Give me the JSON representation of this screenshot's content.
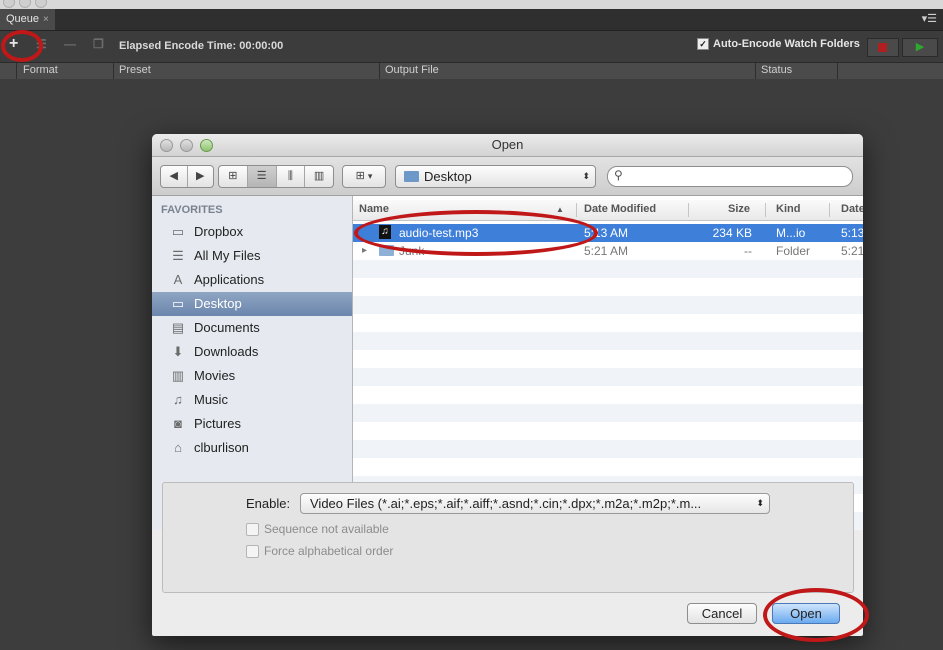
{
  "app": {
    "tab_label": "Queue",
    "tab_close": "×",
    "panel_menu": "▾☰",
    "toolbar": {
      "add_icon": "+",
      "remove_icon": "—",
      "duplicate_icon": "❐",
      "list_icon": "☰",
      "elapsed_label": "Elapsed Encode Time: 00:00:00",
      "auto_encode_label": "Auto-Encode Watch Folders",
      "auto_encode_checked": "✓",
      "play_icon": "▶"
    },
    "columns": [
      "Format",
      "Preset",
      "Output File",
      "Status"
    ]
  },
  "dialog": {
    "title": "Open",
    "nav": {
      "back": "◀",
      "forward": "▶"
    },
    "view_buttons": [
      "⊞",
      "☰",
      "⫼",
      "▥"
    ],
    "arrange": {
      "icon": "⊞",
      "arrow": "▾"
    },
    "location": {
      "label": "Desktop",
      "arrow": "⬍"
    },
    "search": {
      "placeholder": "",
      "icon": "⚲"
    },
    "sidebar": {
      "header": "FAVORITES",
      "items": [
        {
          "label": "Dropbox",
          "icon": "▭"
        },
        {
          "label": "All My Files",
          "icon": "☰"
        },
        {
          "label": "Applications",
          "icon": "A"
        },
        {
          "label": "Desktop",
          "icon": "▭"
        },
        {
          "label": "Documents",
          "icon": "▤"
        },
        {
          "label": "Downloads",
          "icon": "⬇"
        },
        {
          "label": "Movies",
          "icon": "▥"
        },
        {
          "label": "Music",
          "icon": "♫"
        },
        {
          "label": "Pictures",
          "icon": "◙"
        },
        {
          "label": "clburlison",
          "icon": "⌂"
        }
      ],
      "selected": "Desktop"
    },
    "file_list": {
      "headers": {
        "name": "Name",
        "sort": "▲",
        "date_modified": "Date Modified",
        "size": "Size",
        "kind": "Kind",
        "date_added": "Date"
      },
      "rows": [
        {
          "name": "audio-test.mp3",
          "icon": "♫",
          "date": "5:13 AM",
          "size": "234 KB",
          "kind": "M...io",
          "added": "5:13"
        },
        {
          "name": "Junk",
          "icon": "▸",
          "date": "5:21 AM",
          "size": "--",
          "kind": "Folder",
          "added": "5:21"
        }
      ]
    },
    "options": {
      "enable_label": "Enable:",
      "enable_value": "Video Files (*.ai;*.eps;*.aif;*.aiff;*.asnd;*.cin;*.dpx;*.m2a;*.m2p;*.m...",
      "enable_arrow": "⬍",
      "sequence_label": "Sequence not available",
      "force_label": "Force alphabetical order"
    },
    "buttons": {
      "cancel": "Cancel",
      "open": "Open"
    }
  },
  "colors": {
    "annotation": "#c01818",
    "selection": "#3d7fd9",
    "dark_panel": "#3a3a3a"
  }
}
